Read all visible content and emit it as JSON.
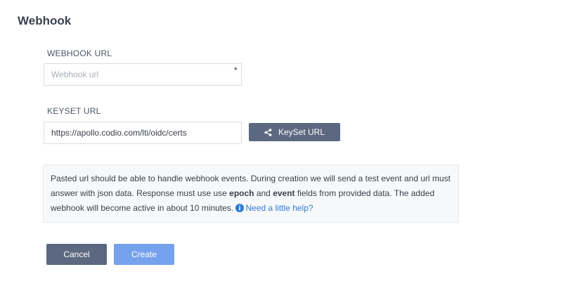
{
  "page": {
    "title": "Webhook"
  },
  "webhook": {
    "label": "WEBHOOK URL",
    "placeholder": "Webhook url",
    "value": "",
    "required_mark": "*"
  },
  "keyset": {
    "label": "KEYSET URL",
    "value": "https://apollo.codio.com/lti/oidc/certs",
    "button_label": "KeySet URL",
    "button_icon": "share-icon"
  },
  "note": {
    "text_1": "Pasted url should be able to handle webhook events. During creation we will send a test event and url must answer with json data. Response must use use ",
    "bold_1": "epoch",
    "text_2": " and ",
    "bold_2": "event",
    "text_3": " fields from provided data. The added webhook will become active in about 10 minutes. ",
    "help_icon": "info-icon",
    "help_link": "Need a little help?"
  },
  "actions": {
    "cancel_label": "Cancel",
    "create_label": "Create"
  },
  "colors": {
    "primary_dark": "#5b6880",
    "primary_light": "#76a1ec",
    "link": "#2f7cd6",
    "note_bg": "#f7f8f9"
  }
}
